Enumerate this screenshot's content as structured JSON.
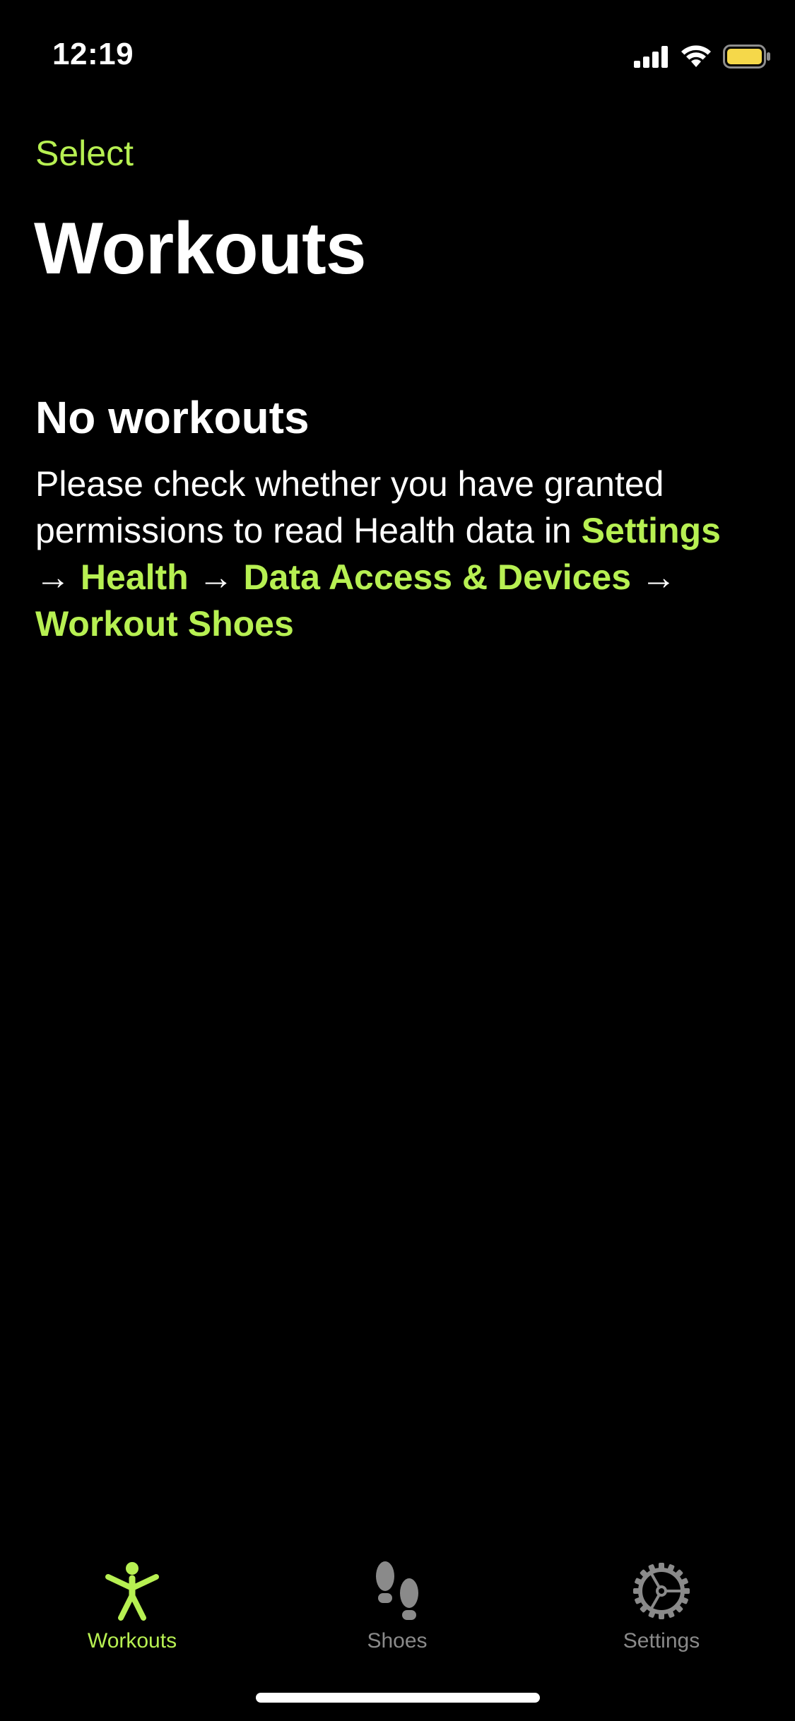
{
  "status_bar": {
    "time": "12:19",
    "icons": [
      "cellular-signal-icon",
      "wifi-icon",
      "battery-icon"
    ],
    "battery_color": "#f5d84a"
  },
  "nav": {
    "select_label": "Select",
    "title": "Workouts"
  },
  "empty_state": {
    "title": "No workouts",
    "message_intro": "Please check whether you have granted permissions to read Health data in",
    "path": [
      "Settings",
      "Health",
      "Data Access & Devices",
      "Workout Shoes"
    ],
    "separator": "→"
  },
  "tab_bar": {
    "tabs": [
      {
        "label": "Workouts",
        "icon": "figure-standing-icon",
        "active": true
      },
      {
        "label": "Shoes",
        "icon": "footprints-icon",
        "active": false
      },
      {
        "label": "Settings",
        "icon": "gear-icon",
        "active": false
      }
    ]
  },
  "colors": {
    "accent": "#b7f052",
    "background": "#000000",
    "inactive_tab": "#8a8a8a"
  }
}
